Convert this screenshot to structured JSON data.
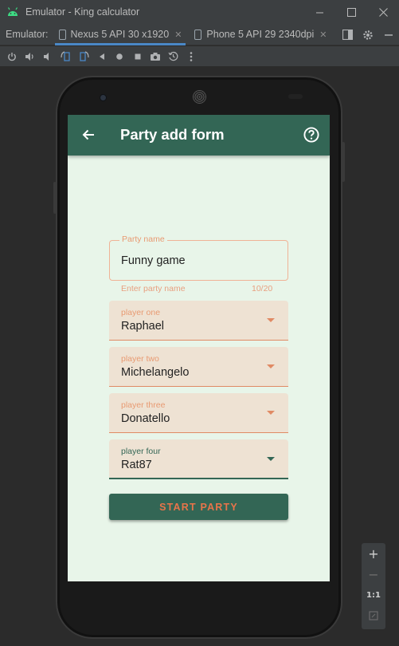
{
  "window": {
    "title": "Emulator - King calculator"
  },
  "tabs": {
    "prefix": "Emulator:",
    "items": [
      {
        "label": "Nexus 5 API 30 x1920",
        "active": true
      },
      {
        "label": "Phone 5 API 29 2340dpi",
        "active": false
      }
    ]
  },
  "app": {
    "title": "Party add form",
    "party_name": {
      "label": "Party name",
      "value": "Funny game",
      "helper": "Enter party name",
      "counter": "10/20"
    },
    "players": [
      {
        "label": "player one",
        "value": "Raphael"
      },
      {
        "label": "player two",
        "value": "Michelangelo"
      },
      {
        "label": "player three",
        "value": "Donatello"
      },
      {
        "label": "player four",
        "value": "Rat87"
      }
    ],
    "start_button": "START PARTY"
  },
  "zoom": {
    "plus": "+",
    "minus": "−",
    "ratio": "1:1"
  },
  "colors": {
    "app_primary": "#336655",
    "app_background": "#e8f5e9",
    "accent_orange": "#e8744a",
    "select_fill": "#eee2d3",
    "ide_chrome": "#3c3f41",
    "active_tab": "#4a88c7"
  }
}
